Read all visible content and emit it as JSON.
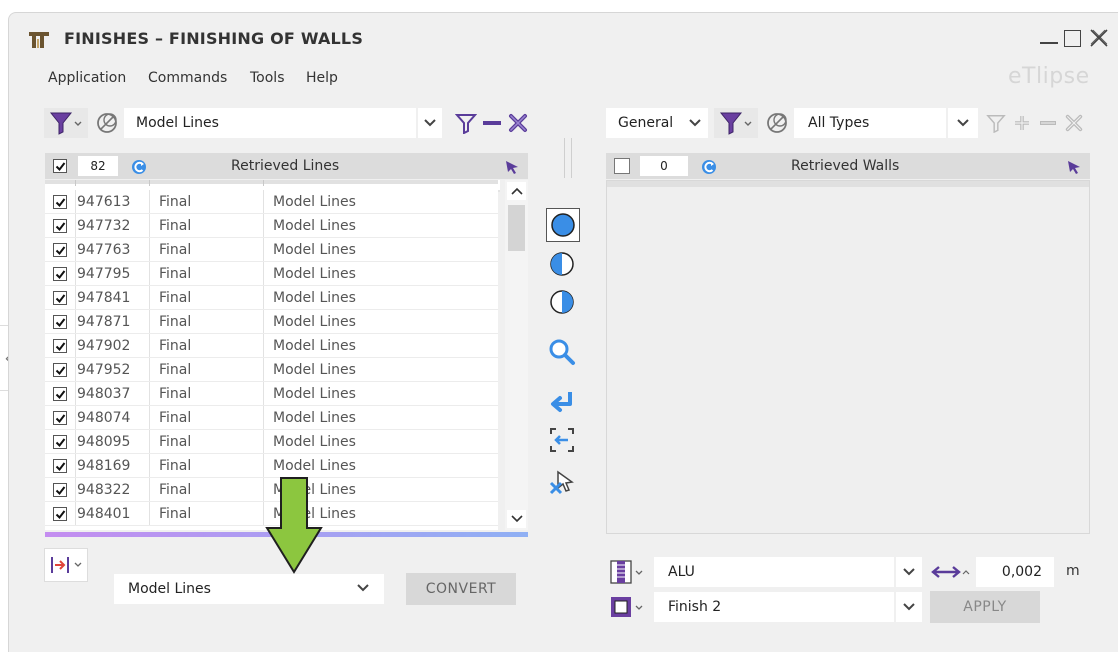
{
  "window": {
    "title": "FINISHES – FINISHING OF WALLS",
    "brand": "eTlipse"
  },
  "menu": [
    "Application",
    "Commands",
    "Tools",
    "Help"
  ],
  "left_panel": {
    "filter_type": "Model Lines",
    "count": "82",
    "header_title": "Retrieved Lines",
    "rows": [
      {
        "id": "947613",
        "status": "Final",
        "category": "Model Lines",
        "checked": true
      },
      {
        "id": "947732",
        "status": "Final",
        "category": "Model Lines",
        "checked": true
      },
      {
        "id": "947763",
        "status": "Final",
        "category": "Model Lines",
        "checked": true
      },
      {
        "id": "947795",
        "status": "Final",
        "category": "Model Lines",
        "checked": true
      },
      {
        "id": "947841",
        "status": "Final",
        "category": "Model Lines",
        "checked": true
      },
      {
        "id": "947871",
        "status": "Final",
        "category": "Model Lines",
        "checked": true
      },
      {
        "id": "947902",
        "status": "Final",
        "category": "Model Lines",
        "checked": true
      },
      {
        "id": "947952",
        "status": "Final",
        "category": "Model Lines",
        "checked": true
      },
      {
        "id": "948037",
        "status": "Final",
        "category": "Model Lines",
        "checked": true
      },
      {
        "id": "948074",
        "status": "Final",
        "category": "Model Lines",
        "checked": true
      },
      {
        "id": "948095",
        "status": "Final",
        "category": "Model Lines",
        "checked": true
      },
      {
        "id": "948169",
        "status": "Final",
        "category": "Model Lines",
        "checked": true
      },
      {
        "id": "948322",
        "status": "Final",
        "category": "Model Lines",
        "checked": true
      },
      {
        "id": "948401",
        "status": "Final",
        "category": "Model Lines",
        "checked": true
      }
    ],
    "convert_select": "Model Lines",
    "convert_button": "CONVERT"
  },
  "right_panel": {
    "mode_select": "General",
    "filter_type": "All Types",
    "count": "0",
    "header_title": "Retrieved Walls",
    "material_select": "ALU",
    "thickness_value": "0,002",
    "thickness_unit": "m",
    "finish_select": "Finish 2",
    "apply_button": "APPLY"
  },
  "colors": {
    "accent_blue": "#3a8ee6",
    "arrow_green": "#8cc63f",
    "filter_purple": "#6a3fa0",
    "list_underline": "#9a8cf0"
  }
}
